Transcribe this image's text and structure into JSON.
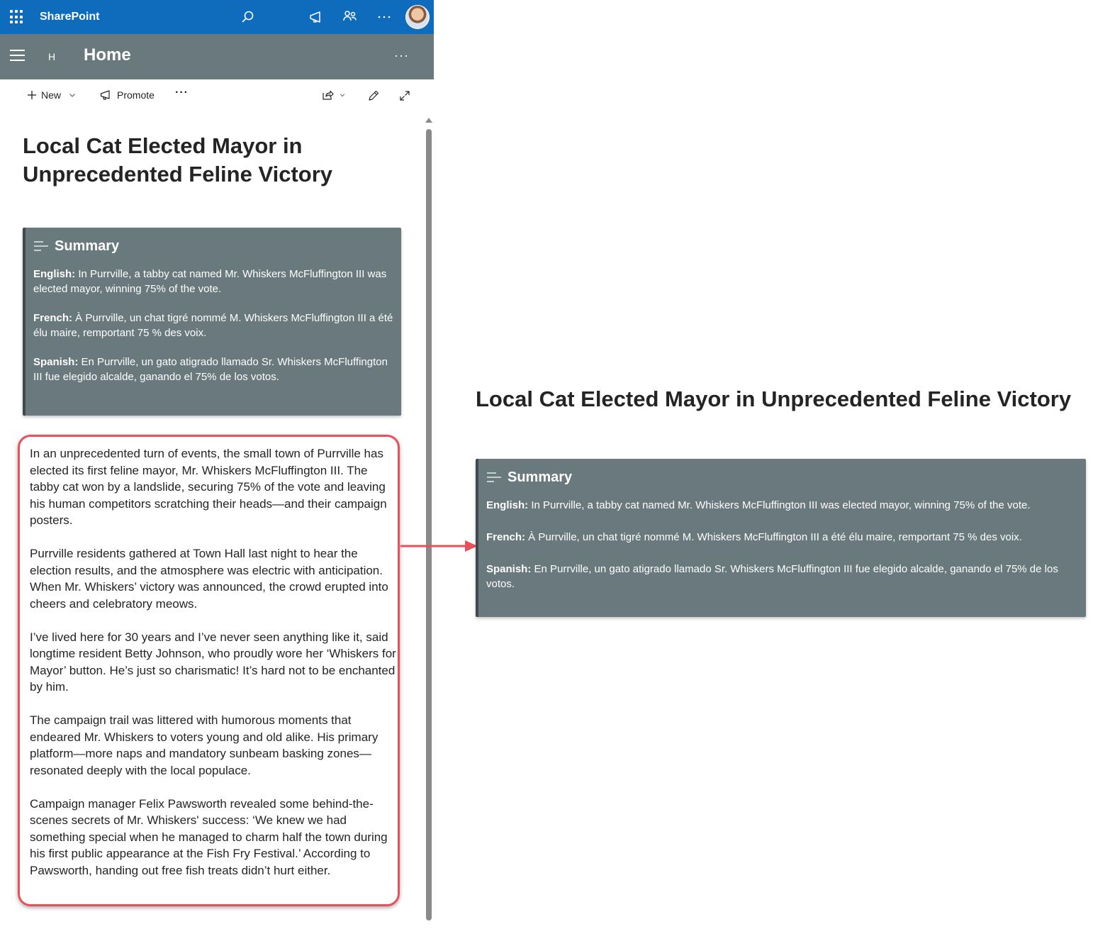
{
  "suite_bar": {
    "brand": "SharePoint",
    "icons": [
      "app-launcher-icon",
      "search-icon",
      "megaphone-icon",
      "share-icon",
      "more-icon",
      "avatar"
    ]
  },
  "site_header": {
    "site_logo": "H",
    "title": "Home",
    "more": "···"
  },
  "command_bar": {
    "new_label": "New",
    "promote_label": "Promote",
    "more": "···"
  },
  "article": {
    "title": "Local Cat Elected Mayor in Unprecedented Feline Victory",
    "paragraphs": [
      "In an unprecedented turn of events, the small town of Purrville has elected its first feline mayor, Mr. Whiskers McFluffington III. The tabby cat won by a landslide, securing 75% of the vote and leaving his human competitors scratching their heads—and their campaign posters.",
      "Purrville residents gathered at Town Hall last night to hear the election results, and the atmosphere was electric with anticipation. When Mr. Whiskers’ victory was announced, the crowd erupted into cheers and celebratory meows.",
      "I’ve lived here for 30 years and I’ve never seen anything like it, said longtime resident Betty Johnson, who proudly wore her ‘Whiskers for Mayor’ button. He’s just so charismatic! It’s hard not to be enchanted by him.",
      "The campaign trail was littered with humorous moments that endeared Mr. Whiskers to voters young and old alike. His primary platform—more naps and mandatory sunbeam basking zones—resonated deeply with the local populace.",
      "Campaign manager Felix Pawsworth revealed some behind-the-scenes secrets of Mr. Whiskers' success: ‘We knew we had something special when he managed to charm half the town during his first public appearance at the Fish Fry Festival.’ According to Pawsworth, handing out free fish treats didn’t hurt either."
    ]
  },
  "summary": {
    "heading": "Summary",
    "items": [
      {
        "language": "English:",
        "text": " In Purrville, a tabby cat named Mr. Whiskers McFluffington III was elected mayor, winning 75% of the vote."
      },
      {
        "language": "French:",
        "text": " À Purrville, un chat tigré nommé M. Whiskers McFluffington III a été élu maire, remportant 75 % des voix."
      },
      {
        "language": "Spanish:",
        "text": " En Purrville, un gato atigrado llamado Sr. Whiskers McFluffington III fue elegido alcalde, ganando el 75% de los votos."
      }
    ]
  },
  "colors": {
    "suite_bar": "#0f6cbd",
    "site_header": "#69797e",
    "summary_background": "#69797e",
    "highlight_border": "#e8505b"
  }
}
